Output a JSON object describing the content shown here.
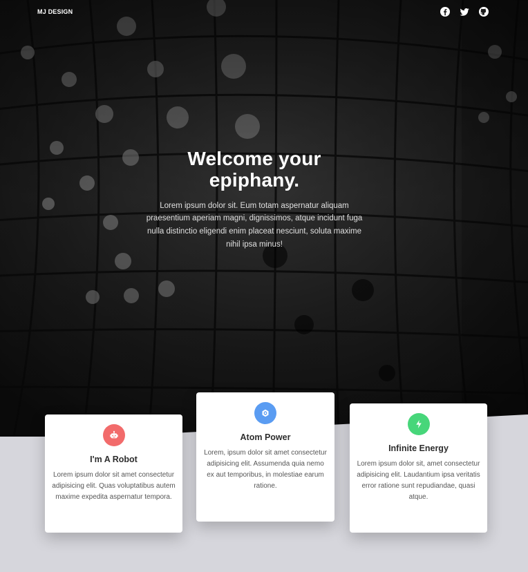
{
  "header": {
    "brand": "MJ DESIGN",
    "social_icons": [
      "facebook-icon",
      "twitter-icon",
      "github-icon"
    ]
  },
  "hero": {
    "title": "Welcome your epiphany.",
    "text": "Lorem ipsum dolor sit. Eum totam aspernatur aliquam praesentium aperiam magni, dignissimos, atque incidunt fuga nulla distinctio eligendi enim placeat nesciunt, soluta maxime nihil ipsa minus!"
  },
  "cards": [
    {
      "icon": "robot-icon",
      "color": "#f26b6b",
      "title": "I'm A Robot",
      "text": "Lorem ipsum dolor sit amet consectetur adipisicing elit. Quas voluptatibus autem maxime expedita aspernatur tempora."
    },
    {
      "icon": "atom-icon",
      "color": "#5a9cf2",
      "title": "Atom Power",
      "text": "Lorem, ipsum dolor sit amet consectetur adipisicing elit. Assumenda quia nemo ex aut temporibus, in molestiae earum ratione."
    },
    {
      "icon": "lightning-icon",
      "color": "#47d67a",
      "title": "Infinite Energy",
      "text": "Lorem ipsum dolor sit, amet consectetur adipisicing elit. Laudantium ipsa veritatis error ratione sunt repudiandae, quasi atque."
    }
  ],
  "colors": {
    "hero_overlay": "#1b1b1b",
    "page_bg": "#d6d6dc",
    "card_bg": "#ffffff"
  }
}
